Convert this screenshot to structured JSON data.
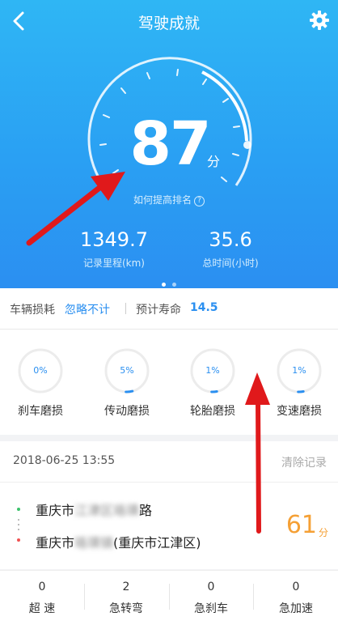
{
  "header": {
    "title": "驾驶成就",
    "score": "87",
    "score_unit": "分",
    "improve_link": "如何提高排名",
    "help_glyph": "?"
  },
  "stats": [
    {
      "value": "1349.7",
      "label": "记录里程(km)"
    },
    {
      "value": "35.6",
      "label": "总时间(小时)"
    }
  ],
  "pager": {
    "pages": 2,
    "active": 1
  },
  "wear": {
    "label": "车辆损耗",
    "ignore": "忽略不计",
    "life_label": "预计寿命",
    "life_value": "14.5",
    "items": [
      {
        "pct": "0%",
        "name": "刹车磨损",
        "fraction": 0.0
      },
      {
        "pct": "5%",
        "name": "传动磨损",
        "fraction": 0.05
      },
      {
        "pct": "1%",
        "name": "轮胎磨损",
        "fraction": 0.01
      },
      {
        "pct": "1%",
        "name": "变速磨损",
        "fraction": 0.01
      }
    ]
  },
  "trip": {
    "datetime": "2018-06-25  13:55",
    "clear": "清除记录",
    "start": {
      "prefix": "重庆市",
      "blurred": "江津区珞璜",
      "suffix": "路"
    },
    "end": {
      "prefix": "重庆市",
      "blurred": "珞璜镇",
      "suffix": "(重庆市江津区)"
    },
    "score": "61",
    "unit": "分"
  },
  "counters": [
    {
      "count": "0",
      "label": "超  速"
    },
    {
      "count": "2",
      "label": "急转弯"
    },
    {
      "count": "0",
      "label": "急刹车"
    },
    {
      "count": "0",
      "label": "急加速"
    }
  ],
  "colors": {
    "accent": "#2a8ff0",
    "score_orange": "#f5a035",
    "arrow": "#e0191b"
  }
}
